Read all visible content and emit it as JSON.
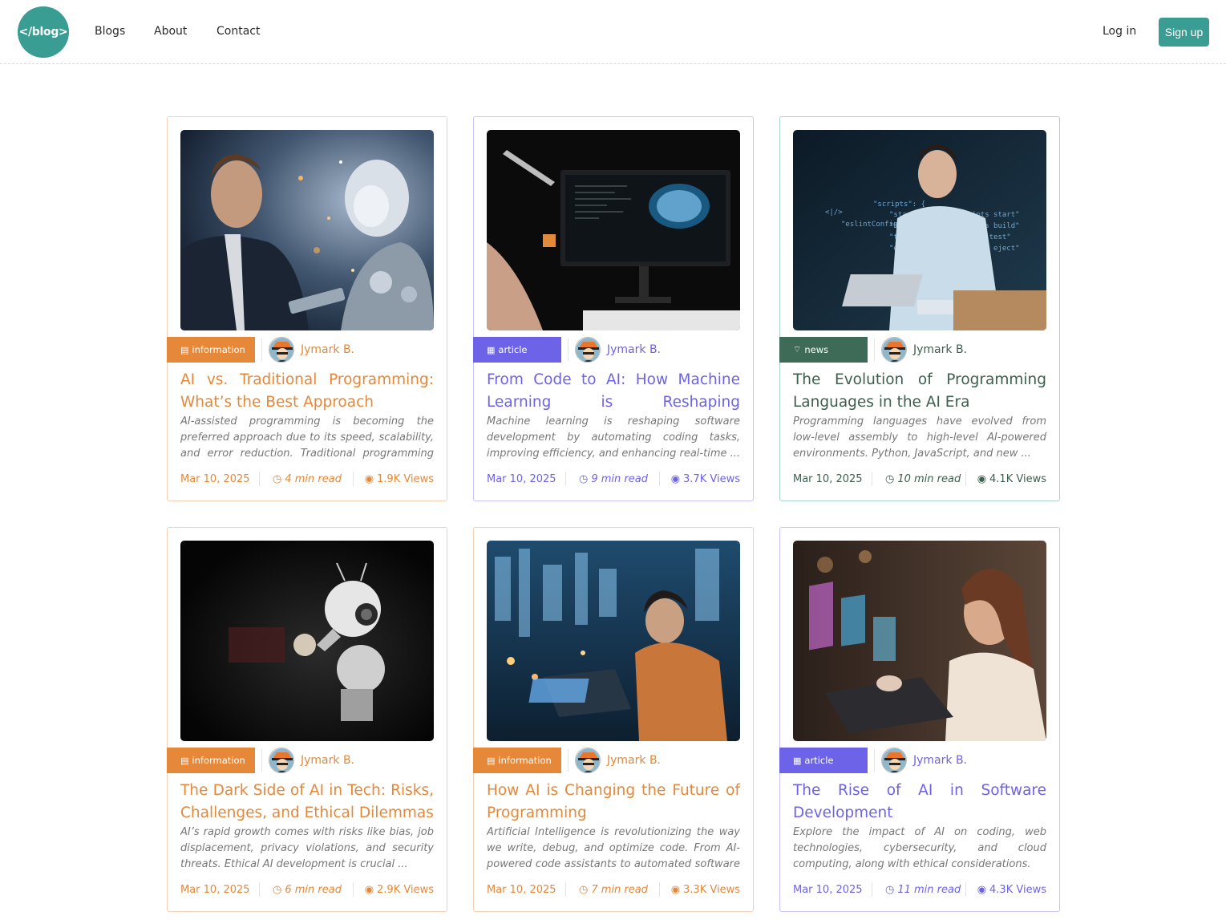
{
  "header": {
    "logo_text": "</blog>",
    "nav": [
      "Blogs",
      "About",
      "Contact"
    ],
    "login_label": "Log in",
    "signup_label": "Sign up"
  },
  "colors": {
    "brand_teal": "#3a9d94",
    "information_orange": "#e5883a",
    "article_purple": "#6d63e8",
    "news_green": "#3d6b57"
  },
  "posts": [
    {
      "category": "information",
      "category_icon": "document-icon",
      "author": "Jymark B.",
      "title": "AI vs. Traditional Programming: What’s the Best Approach",
      "excerpt": "AI-assisted programming is becoming the preferred approach due to its speed, scalability, and error reduction. Traditional programming remai...",
      "date": "Mar 10, 2025",
      "read_time": "4 min read",
      "views": "1.9K Views",
      "image": "man-and-ai-robot-photo"
    },
    {
      "category": "article",
      "category_icon": "newspaper-icon",
      "author": "Jymark B.",
      "title": "From Code to AI: How Machine Learning is Reshaping Development",
      "excerpt": "Machine learning is reshaping software development by automating coding tasks, improving efficiency, and enhancing real-time ...",
      "date": "Mar 10, 2025",
      "read_time": "9 min read",
      "views": "3.7K Views",
      "image": "monitor-with-brain-photo"
    },
    {
      "category": "news",
      "category_icon": "rss-icon",
      "author": "Jymark B.",
      "title": "The Evolution of Programming Languages in the AI Era",
      "excerpt": "Programming languages have evolved from low-level assembly to high-level AI-powered environments. Python, JavaScript, and new ...",
      "date": "Mar 10, 2025",
      "read_time": "10 min read",
      "views": "4.1K Views",
      "image": "developer-with-code-overlay-photo"
    },
    {
      "category": "information",
      "category_icon": "document-icon",
      "author": "Jymark B.",
      "title": "The Dark Side of AI in Tech: Risks, Challenges, and Ethical Dilemmas",
      "excerpt": "AI’s rapid growth comes with risks like bias, job displacement, privacy violations, and security threats. Ethical AI development is crucial ...",
      "date": "Mar 10, 2025",
      "read_time": "6 min read",
      "views": "2.9K Views",
      "image": "robot-in-dark-photo"
    },
    {
      "category": "information",
      "category_icon": "document-icon",
      "author": "Jymark B.",
      "title": "How AI is Changing the Future of Programming",
      "excerpt": "Artificial Intelligence is revolutionizing the way we write, debug, and optimize code. From AI-powered code assistants to automated software testing, t...",
      "date": "Mar 10, 2025",
      "read_time": "7 min read",
      "views": "3.3K Views",
      "image": "boy-with-laptop-city-photo"
    },
    {
      "category": "article",
      "category_icon": "newspaper-icon",
      "author": "Jymark B.",
      "title": "The Rise of AI in Software Development",
      "excerpt": "Explore the impact of AI on coding, web technologies, cybersecurity, and cloud computing, along with ethical considerations.",
      "date": "Mar 10, 2025",
      "read_time": "11 min read",
      "views": "4.3K Views",
      "image": "woman-with-holographic-laptop-photo"
    }
  ]
}
